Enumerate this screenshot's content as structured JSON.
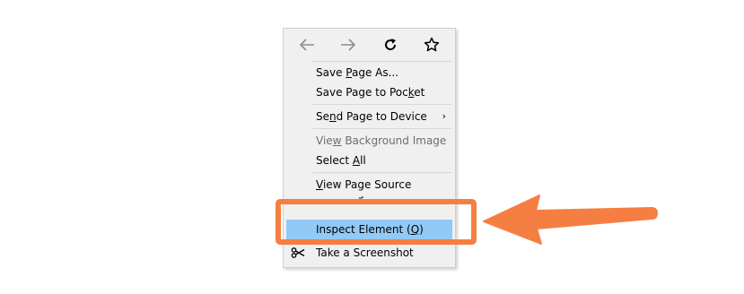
{
  "context_menu": {
    "nav_icons": [
      "back-arrow-icon",
      "forward-arrow-icon",
      "reload-icon",
      "bookmark-star-icon"
    ],
    "items": [
      {
        "pre": "Save ",
        "u": "P",
        "post": "age As..."
      },
      {
        "pre": "Save Page to Poc",
        "u": "k",
        "post": "et"
      },
      {
        "pre": "Se",
        "u": "n",
        "post": "d Page to Device",
        "submenu": "›"
      },
      {
        "pre": "Vie",
        "u": "w",
        "post": " Background Image"
      },
      {
        "pre": "Select ",
        "u": "A",
        "post": "ll"
      },
      {
        "pre": "",
        "u": "V",
        "post": "iew Page Source"
      },
      {
        "pre": "Inspect Element (",
        "u": "Q",
        "post": ")"
      },
      {
        "pre": "Take a Screenshot",
        "u": "",
        "post": ""
      }
    ]
  },
  "colors": {
    "highlight": "#91c9f7",
    "callout": "#f57f42",
    "menu_bg": "#f0f0f0",
    "disabled_text": "#6d6d6d"
  }
}
